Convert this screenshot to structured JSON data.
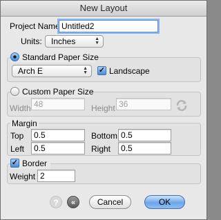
{
  "window": {
    "title": "New Layout"
  },
  "project": {
    "name_label": "Project Name",
    "name_value": "Untitled2"
  },
  "units": {
    "label": "Units:",
    "value": "Inches"
  },
  "standard_paper": {
    "label": "Standard Paper Size",
    "selected": true,
    "size_value": "Arch E",
    "landscape_label": "Landscape",
    "landscape_checked": true
  },
  "custom_paper": {
    "label": "Custom Paper Size",
    "selected": false,
    "width_label": "Width",
    "width_value": "48",
    "height_label": "Height",
    "height_value": "36"
  },
  "margin": {
    "label": "Margin",
    "top_label": "Top",
    "top_value": "0.5",
    "bottom_label": "Bottom",
    "bottom_value": "0.5",
    "left_label": "Left",
    "left_value": "0.5",
    "right_label": "Right",
    "right_value": "0.5"
  },
  "border": {
    "label": "Border",
    "checked": true,
    "weight_label": "Weight",
    "weight_value": "2"
  },
  "buttons": {
    "cancel": "Cancel",
    "ok": "OK"
  },
  "icons": {
    "help": "help-icon",
    "back": "back-icon",
    "swap": "swap-icon"
  },
  "colors": {
    "accent": "#6ea6ea",
    "focus_ring": "#8fb4ea"
  }
}
